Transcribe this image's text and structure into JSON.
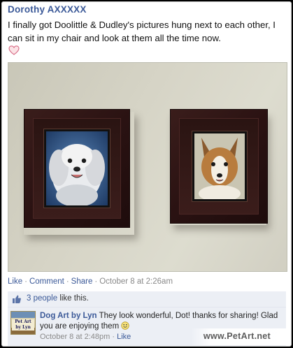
{
  "post": {
    "author": "Dorothy AXXXXX",
    "text": "I finally got Doolittle & Dudley's pictures hung next to each other, I can sit in my chair and look at them all the time now.",
    "heart_icon": "heart-icon"
  },
  "photo": {
    "left_subject": "white maltese dog portrait",
    "right_subject": "sheltie dog portrait"
  },
  "actions": {
    "like_label": "Like",
    "comment_label": "Comment",
    "share_label": "Share",
    "separator": "·",
    "timestamp": "October 8 at 2:26am"
  },
  "likes": {
    "count_label": "3 people",
    "suffix": " like this."
  },
  "comment": {
    "author": "Dog Art by Lyn",
    "avatar_text": "Pet Art by Lyn",
    "text": "They look wonderful, Dot! thanks for sharing! Glad you are enjoying them",
    "timestamp": "October 8 at 2:48pm",
    "separator": "·",
    "like_label": "Like"
  },
  "watermark": "www.PetArt.net",
  "colors": {
    "link": "#3b5998",
    "muted": "#8a8a8a",
    "comment_bg": "#eceff5",
    "frame_wood": "#2a1212"
  }
}
